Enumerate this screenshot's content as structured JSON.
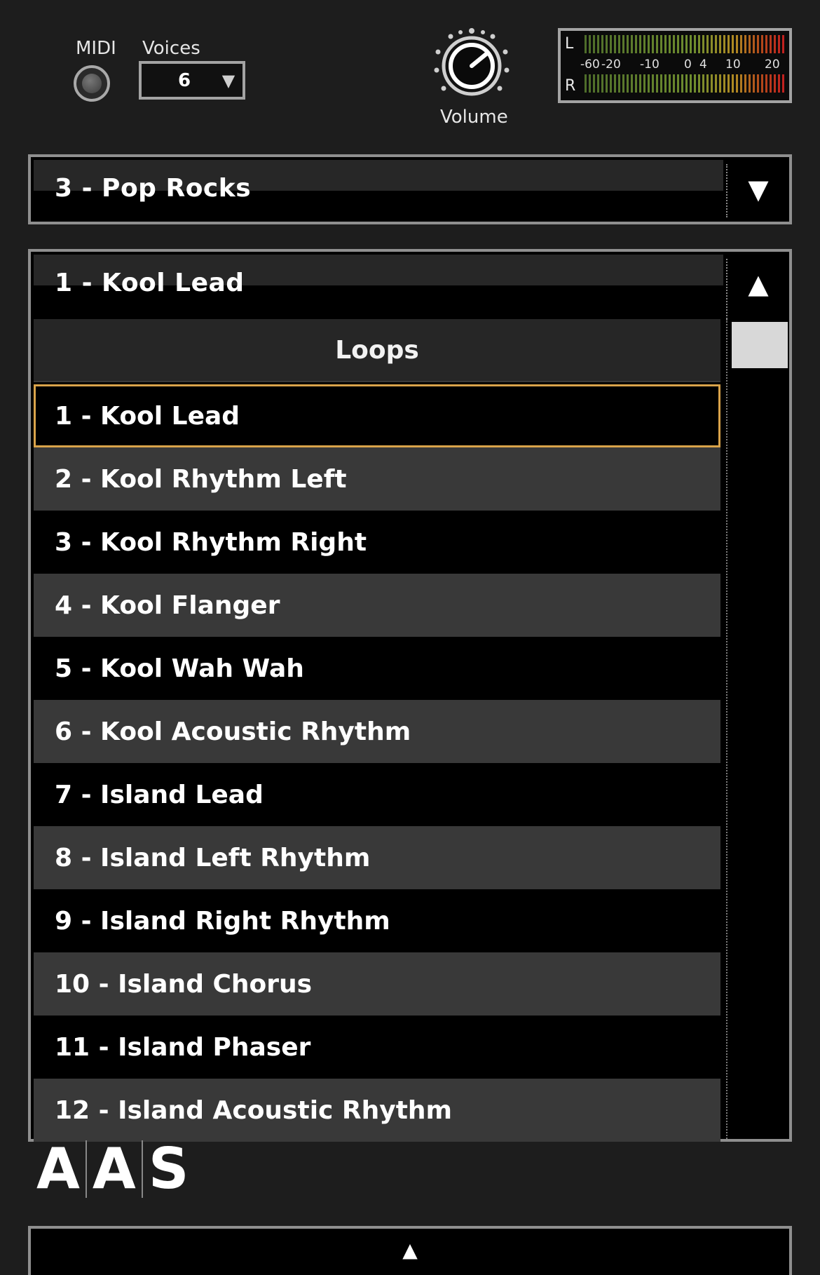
{
  "header": {
    "midi_label": "MIDI",
    "voices_label": "Voices",
    "voices_value": "6",
    "volume_label": "Volume"
  },
  "meter": {
    "left_label": "L",
    "right_label": "R",
    "scale": [
      "-60",
      "-20",
      "-10",
      "0",
      "4",
      "10",
      "20"
    ]
  },
  "preset": {
    "selected": "3 - Pop Rocks"
  },
  "loops": {
    "current": "1 - Kool Lead",
    "list_title": "Loops",
    "items": [
      "1 - Kool Lead",
      "2 - Kool Rhythm Left",
      "3 - Kool Rhythm Right",
      "4 - Kool Flanger",
      "5 - Kool Wah Wah",
      "6 - Kool Acoustic Rhythm",
      "7 - Island Lead",
      "8 - Island Left Rhythm",
      "9 - Island Right Rhythm",
      "10 - Island Chorus",
      "11 - Island Phaser",
      "12 - Island Acoustic Rhythm"
    ],
    "selected_index": 0
  },
  "logo": {
    "letters": [
      "A",
      "A",
      "S"
    ]
  },
  "icons": {
    "dropdown": "triangle-down-icon",
    "collapse": "triangle-up-icon",
    "expand": "triangle-up-icon"
  },
  "colors": {
    "background": "#1d1d1d",
    "selection_border": "#d9a34a",
    "row_alt": "#393939"
  }
}
